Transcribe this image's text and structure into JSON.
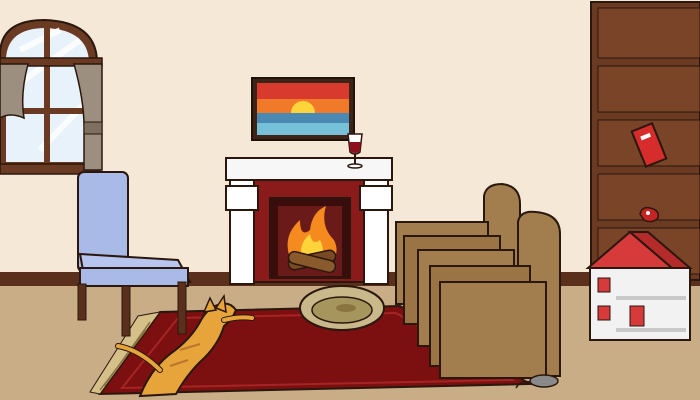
{
  "scene": {
    "room": "living-room",
    "objects": [
      {
        "id": "window",
        "name": "window",
        "interactable": true
      },
      {
        "id": "painting",
        "name": "sunset-painting",
        "interactable": true
      },
      {
        "id": "fireplace",
        "name": "fireplace",
        "interactable": true
      },
      {
        "id": "wine-glass",
        "name": "wine-glass",
        "interactable": true
      },
      {
        "id": "chair",
        "name": "blue-chair",
        "interactable": true
      },
      {
        "id": "armchairs",
        "name": "armchairs",
        "interactable": true
      },
      {
        "id": "bookshelf",
        "name": "bookshelf",
        "interactable": true
      },
      {
        "id": "red-book",
        "name": "red-book",
        "interactable": true
      },
      {
        "id": "small-item",
        "name": "red-trinket",
        "interactable": true
      },
      {
        "id": "dollhouse",
        "name": "dollhouse",
        "interactable": true
      },
      {
        "id": "cat",
        "name": "orange-cat",
        "interactable": true
      },
      {
        "id": "pet-bed",
        "name": "pet-bed",
        "interactable": true
      },
      {
        "id": "rug",
        "name": "red-rug",
        "interactable": true
      },
      {
        "id": "mouse",
        "name": "toy-mouse",
        "interactable": true
      }
    ]
  },
  "colors": {
    "wall": "#f6e8d6",
    "floor": "#c8ad87",
    "rug": "#7c1010",
    "wood": "#6b3a22",
    "chair": "#a9b9e8",
    "armchair": "#a27d4d",
    "cat": "#e6a43a"
  }
}
